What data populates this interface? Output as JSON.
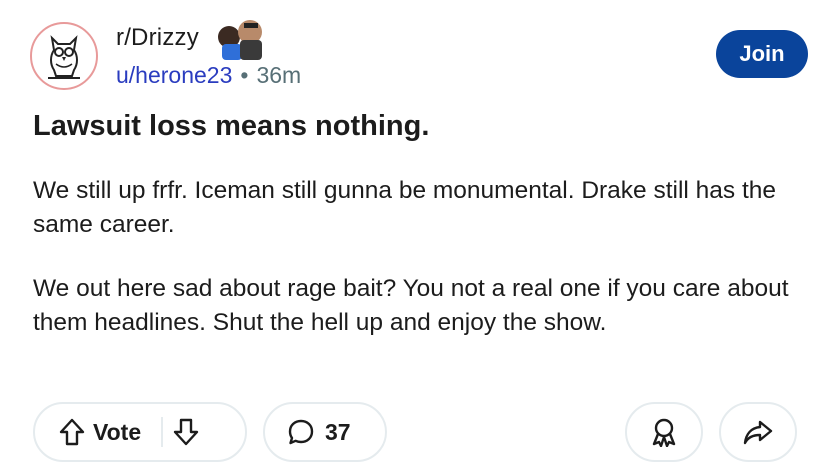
{
  "header": {
    "subreddit": "r/Drizzy",
    "author": "u/herone23",
    "separator": "•",
    "age": "36m",
    "join_label": "Join"
  },
  "post": {
    "title": "Lawsuit loss means nothing.",
    "paragraphs": [
      "We still up frfr. Iceman still gunna be monumental. Drake still has the same career.",
      "We out here sad about rage bait? You not a real one if you care about them headlines. Shut the hell up and enjoy the show."
    ]
  },
  "actions": {
    "vote_label": "Vote",
    "comment_count": "37"
  },
  "colors": {
    "join_bg": "#0a449b",
    "username": "#2a3cbf",
    "meta": "#576f76",
    "pill_border": "#e5ebee"
  },
  "icons": [
    "owl-logo-icon",
    "user-flair-icon",
    "upvote-arrow-icon",
    "downvote-arrow-icon",
    "comment-bubble-icon",
    "award-icon",
    "share-arrow-icon"
  ]
}
